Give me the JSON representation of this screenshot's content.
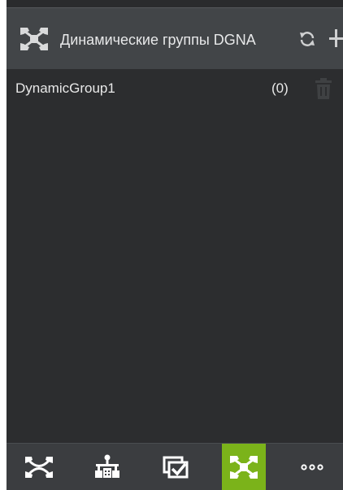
{
  "header": {
    "title": "Динамические группы DGNA",
    "icon": "dgna-group-icon",
    "refresh_icon": "refresh-icon",
    "add_icon": "plus-icon"
  },
  "groups": [
    {
      "name": "DynamicGroup1",
      "count": "(0)",
      "delete_icon": "trash-icon"
    }
  ],
  "bottom_nav": {
    "items": [
      {
        "icon": "group-link-icon",
        "active": false
      },
      {
        "icon": "hierarchy-icon",
        "active": false
      },
      {
        "icon": "checkbox-window-icon",
        "active": false
      },
      {
        "icon": "dgna-group-icon",
        "active": true
      },
      {
        "icon": "more-icon",
        "active": false
      }
    ]
  },
  "colors": {
    "background": "#2c2d2f",
    "header": "#424548",
    "bottom_bar": "#3b3d40",
    "accent": "#7bb31a",
    "text": "#e9e9e9",
    "icon_muted": "#3f4143"
  }
}
